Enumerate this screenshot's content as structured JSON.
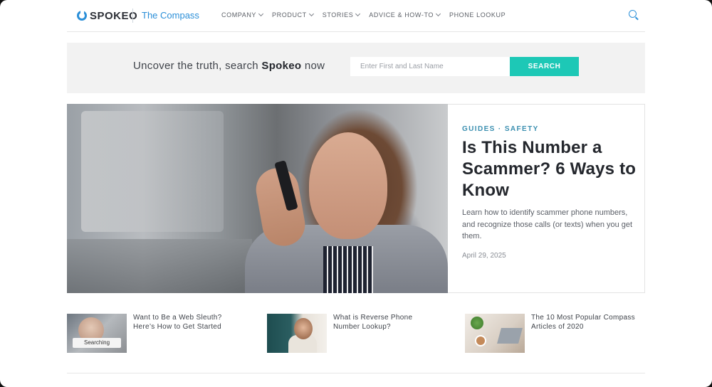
{
  "header": {
    "logo_text": "SPOKEO",
    "site_name": "The Compass",
    "nav": [
      {
        "label": "COMPANY",
        "has_dropdown": true
      },
      {
        "label": "PRODUCT",
        "has_dropdown": true
      },
      {
        "label": "STORIES",
        "has_dropdown": true
      },
      {
        "label": "ADVICE & HOW-TO",
        "has_dropdown": true
      },
      {
        "label": "PHONE LOOKUP",
        "has_dropdown": false
      }
    ],
    "search_icon": "search-icon"
  },
  "search_band": {
    "prefix": "Uncover the truth, search",
    "brand": "Spokeo",
    "suffix": "now",
    "placeholder": "Enter First and Last Name",
    "button_label": "SEARCH",
    "button_color": "#1dc8b6"
  },
  "hero": {
    "category": "GUIDES · SAFETY",
    "title": "Is This Number a Scammer? 6 Ways to Know",
    "description": "Learn how to identify scammer phone numbers, and recognize those calls (or texts) when you get them.",
    "date": "April 29, 2025"
  },
  "articles": [
    {
      "title": "Want to Be a Web Sleuth? Here’s How to Get Started",
      "thumb_text": "Searching"
    },
    {
      "title": "What is Reverse Phone Number Lookup?"
    },
    {
      "title": "The 10 Most Popular Compass Articles of 2020"
    }
  ],
  "colors": {
    "accent": "#2b8fd8",
    "category": "#3b8fb0"
  }
}
